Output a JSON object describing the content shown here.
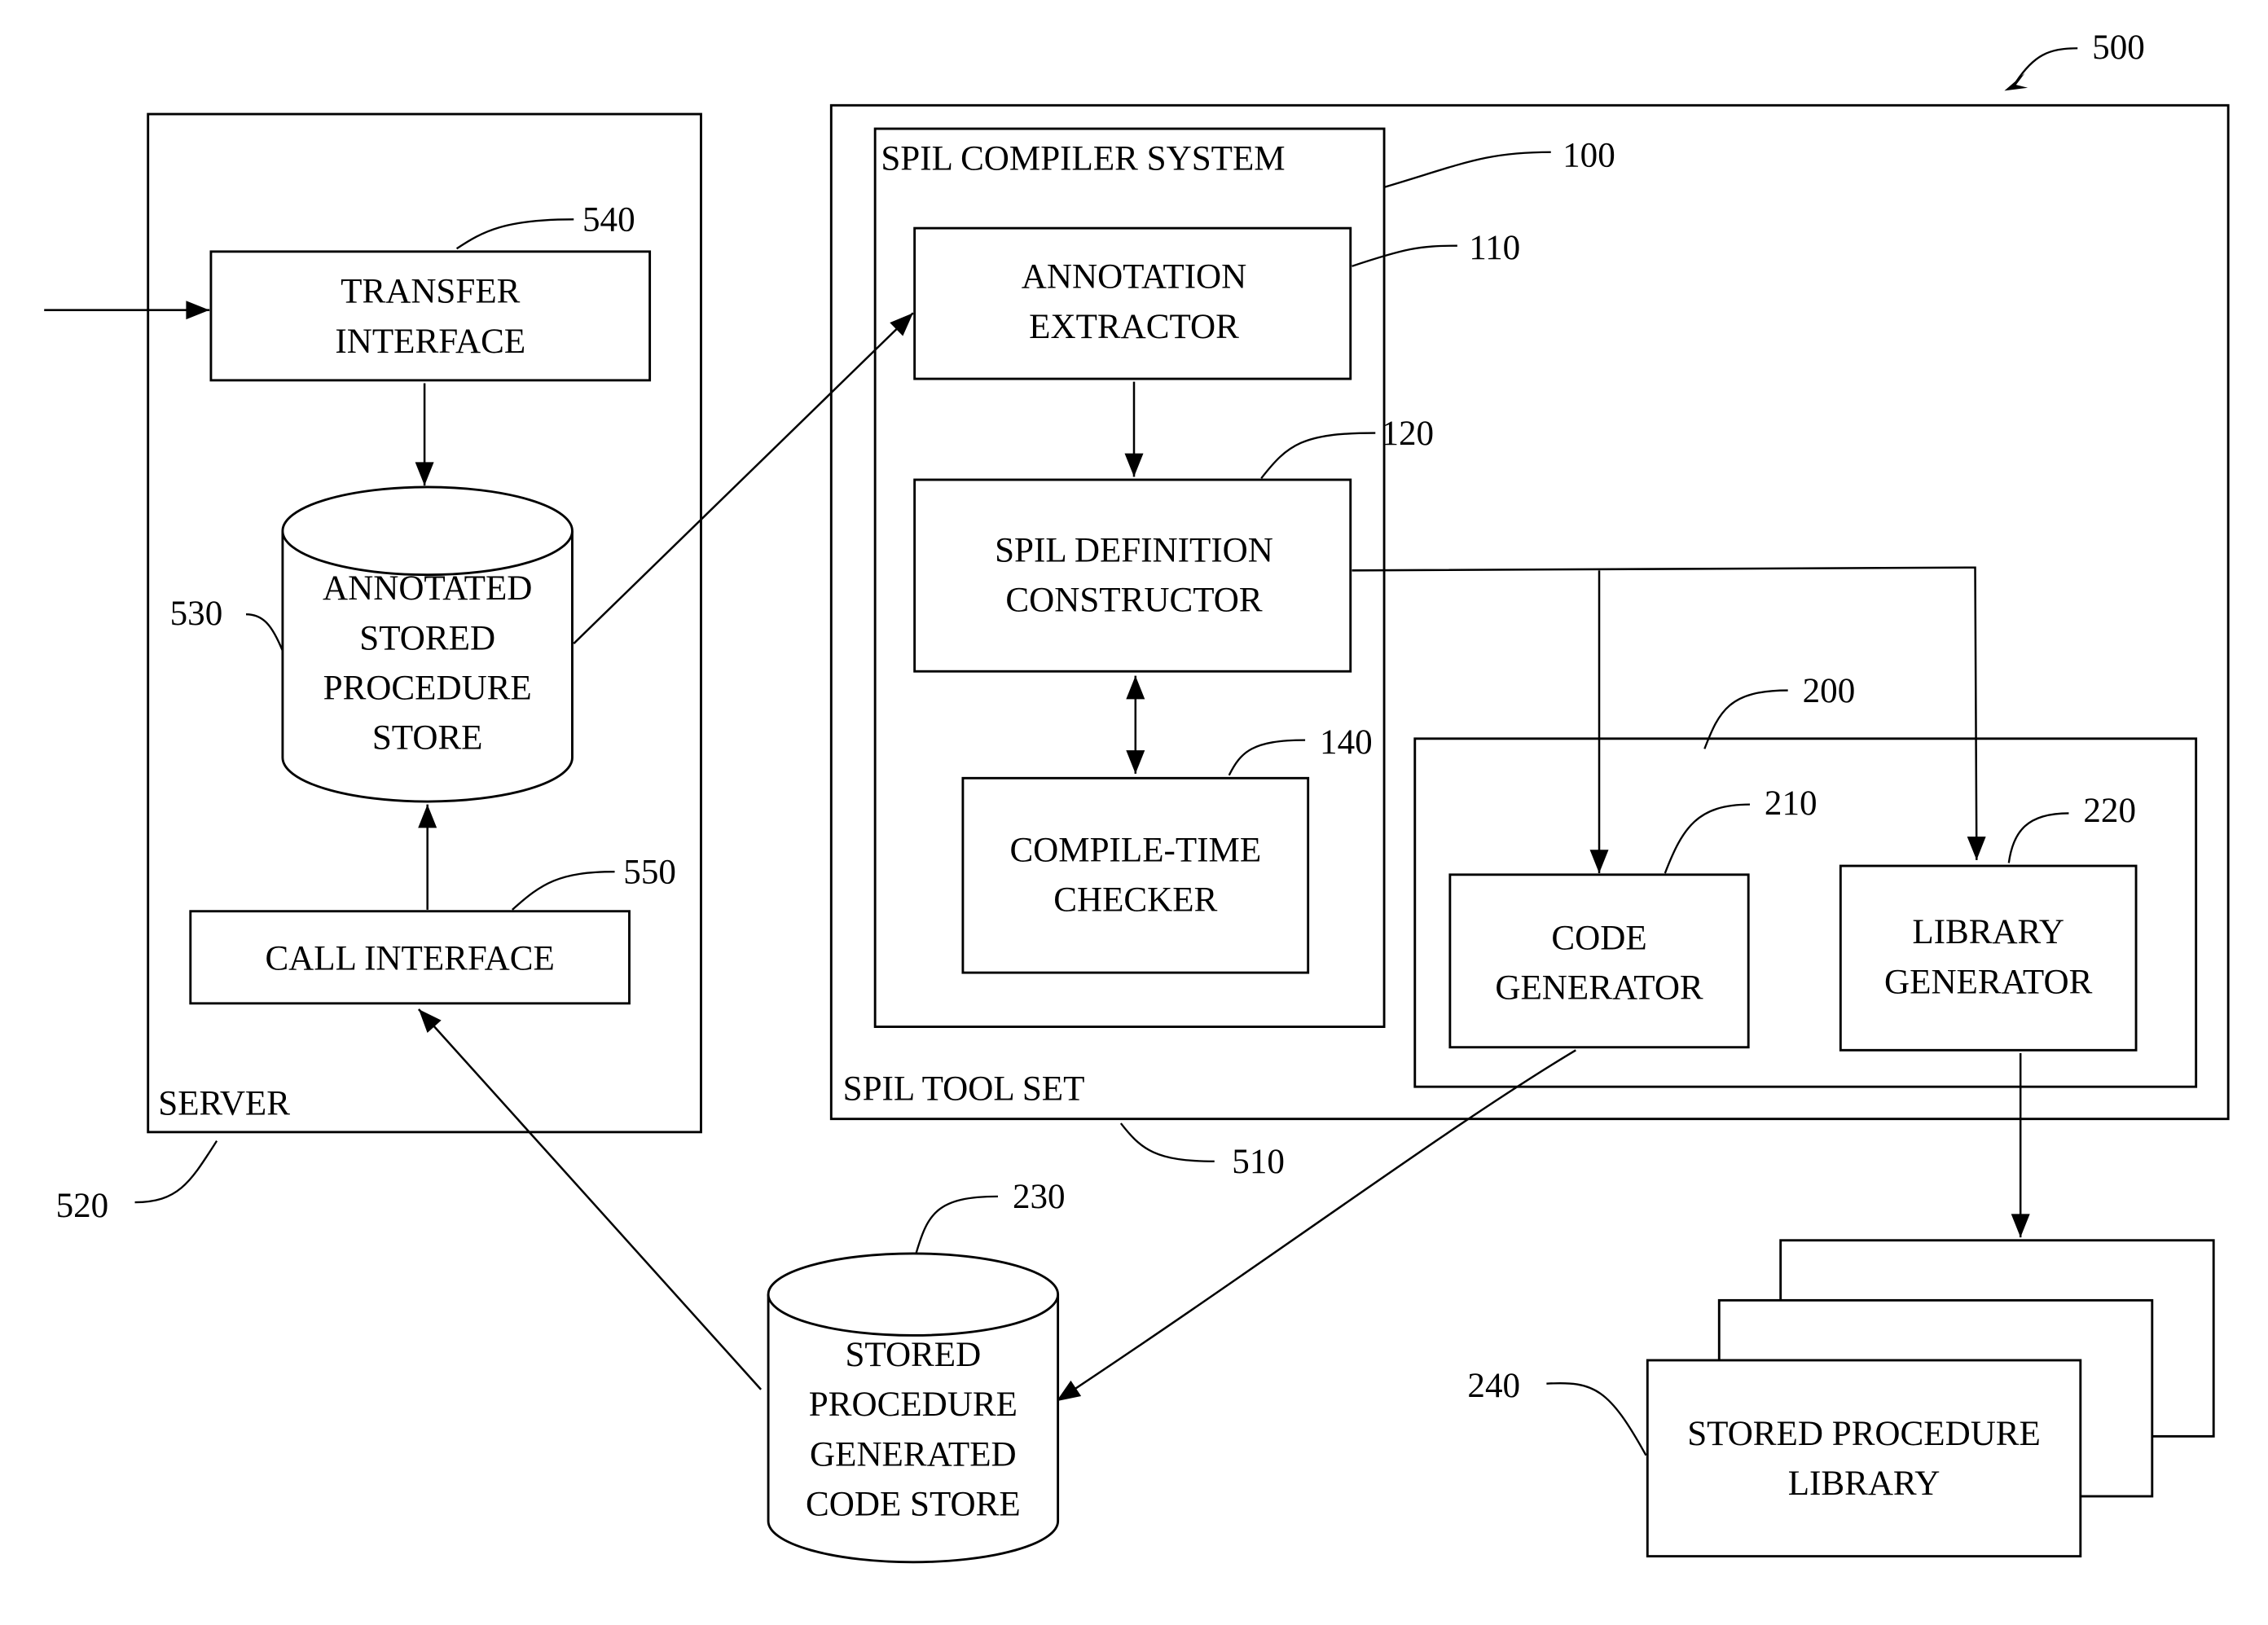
{
  "figure": {
    "ref": "500"
  },
  "server": {
    "title": "SERVER",
    "ref": "520",
    "transfer_interface": {
      "lines": [
        "TRANSFER",
        "INTERFACE"
      ],
      "ref": "540"
    },
    "annotated_store": {
      "lines": [
        "ANNOTATED",
        "STORED",
        "PROCEDURE",
        "STORE"
      ],
      "ref": "530"
    },
    "call_interface": {
      "lines": [
        "CALL INTERFACE"
      ],
      "ref": "550"
    }
  },
  "tool_set": {
    "title": "SPIL TOOL SET",
    "ref": "510",
    "compiler_system": {
      "title": "SPIL COMPILER  SYSTEM",
      "ref": "100",
      "annotation_extractor": {
        "lines": [
          "ANNOTATION",
          "EXTRACTOR"
        ],
        "ref": "110"
      },
      "definition_constructor": {
        "lines": [
          "SPIL DEFINITION",
          "CONSTRUCTOR"
        ],
        "ref": "120"
      },
      "compile_time_checker": {
        "lines": [
          "COMPILE-TIME",
          "CHECKER"
        ],
        "ref": "140"
      }
    },
    "generators": {
      "ref": "200",
      "code_generator": {
        "lines": [
          "CODE",
          "GENERATOR"
        ],
        "ref": "210"
      },
      "library_generator": {
        "lines": [
          "LIBRARY",
          "GENERATOR"
        ],
        "ref": "220"
      }
    }
  },
  "generated_code_store": {
    "lines": [
      "STORED",
      "PROCEDURE",
      "GENERATED",
      "CODE STORE"
    ],
    "ref": "230"
  },
  "procedure_library": {
    "lines": [
      "STORED PROCEDURE",
      "LIBRARY"
    ],
    "ref": "240"
  }
}
